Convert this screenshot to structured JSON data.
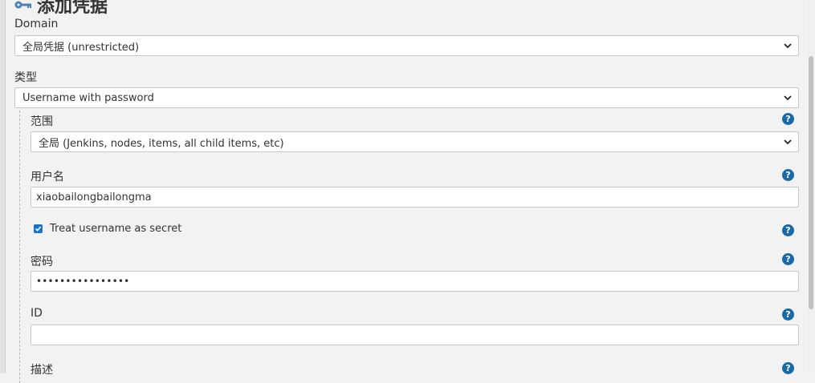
{
  "title": "添加凭据",
  "domain": {
    "label": "Domain",
    "selected": "全局凭据 (unrestricted)"
  },
  "kind": {
    "label": "类型",
    "selected": "Username with password"
  },
  "scope": {
    "label": "范围",
    "selected": "全局 (Jenkins, nodes, items, all child items, etc)"
  },
  "username": {
    "label": "用户名",
    "value": "xiaobailongbailongma"
  },
  "secret_checkbox": {
    "label": "Treat username as secret",
    "checked": true
  },
  "password": {
    "label": "密码",
    "value": "••••••••••••••••"
  },
  "id_field": {
    "label": "ID",
    "value": ""
  },
  "description": {
    "label": "描述"
  },
  "help_glyph": "?",
  "colors": {
    "background": "#f2f2f2",
    "help_icon": "#1a6aa8",
    "checkbox": "#1a73c8"
  }
}
